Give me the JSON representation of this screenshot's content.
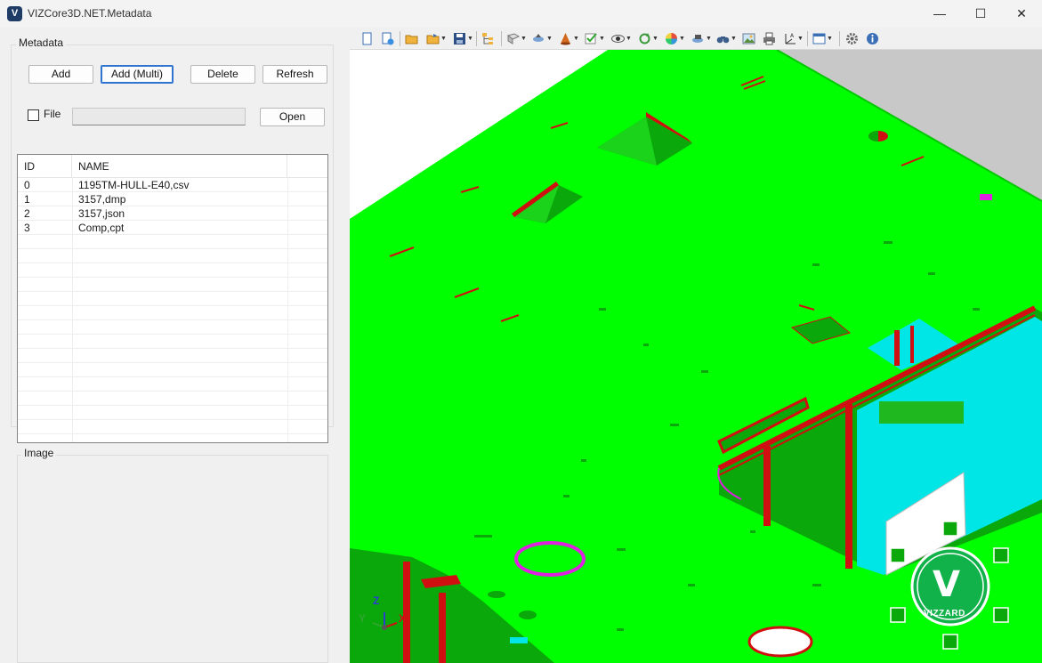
{
  "window": {
    "title": "VIZCore3D.NET.Metadata",
    "app_icon_letter": "V",
    "min_glyph": "—",
    "max_glyph": "☐",
    "close_glyph": "✕"
  },
  "metadata_panel": {
    "group_label": "Metadata",
    "buttons": {
      "add": "Add",
      "add_multi": "Add (Multi)",
      "delete": "Delete",
      "refresh": "Refresh",
      "open": "Open"
    },
    "file_checkbox_label": "File",
    "file_checkbox_checked": false,
    "file_path_value": "",
    "table": {
      "columns": [
        "ID",
        "NAME"
      ],
      "rows": [
        {
          "id": "0",
          "name": "1195TM-HULL-E40,csv"
        },
        {
          "id": "1",
          "name": "3157,dmp"
        },
        {
          "id": "2",
          "name": "3157,json"
        },
        {
          "id": "3",
          "name": "Comp,cpt"
        }
      ]
    }
  },
  "image_panel": {
    "group_label": "Image"
  },
  "viewer": {
    "toolbar_icons": [
      "new-document-icon",
      "new-window-icon",
      "open-folder-icon",
      "open-file-dropdown-icon",
      "save-dropdown-icon",
      "model-tree-icon",
      "view-dropdown-icon",
      "navigation-dropdown-icon",
      "render-cone-dropdown-icon",
      "check-dropdown-icon",
      "visibility-eye-dropdown-icon",
      "rotate-dropdown-icon",
      "color-palette-dropdown-icon",
      "camera-dropdown-icon",
      "binoculars-find-dropdown-icon",
      "image-export-icon",
      "print-icon",
      "axis-dropdown-icon",
      "window-layout-dropdown-icon",
      "settings-gear-icon",
      "info-icon"
    ],
    "axis_labels": {
      "x": "X",
      "y": "Y",
      "z": "Z"
    },
    "logo_text": "VIZZARD",
    "logo_letter": "V",
    "colors": {
      "hull_green": "#00ff00",
      "dark_green": "#0a9a0a",
      "hull_red": "#d01010",
      "cyan": "#00e6e6",
      "magenta": "#e020e0",
      "background_gray": "#c8c8c8"
    }
  }
}
